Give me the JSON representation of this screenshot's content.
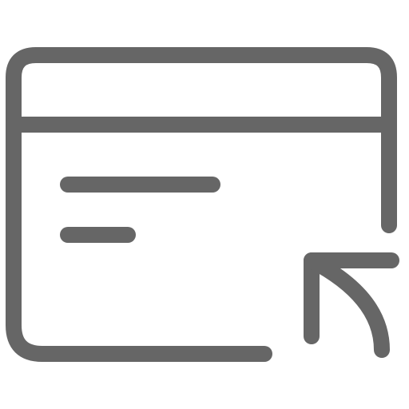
{
  "icon": {
    "name": "card-with-return-arrow-icon",
    "color": "#666666",
    "background": "#ffffff"
  }
}
